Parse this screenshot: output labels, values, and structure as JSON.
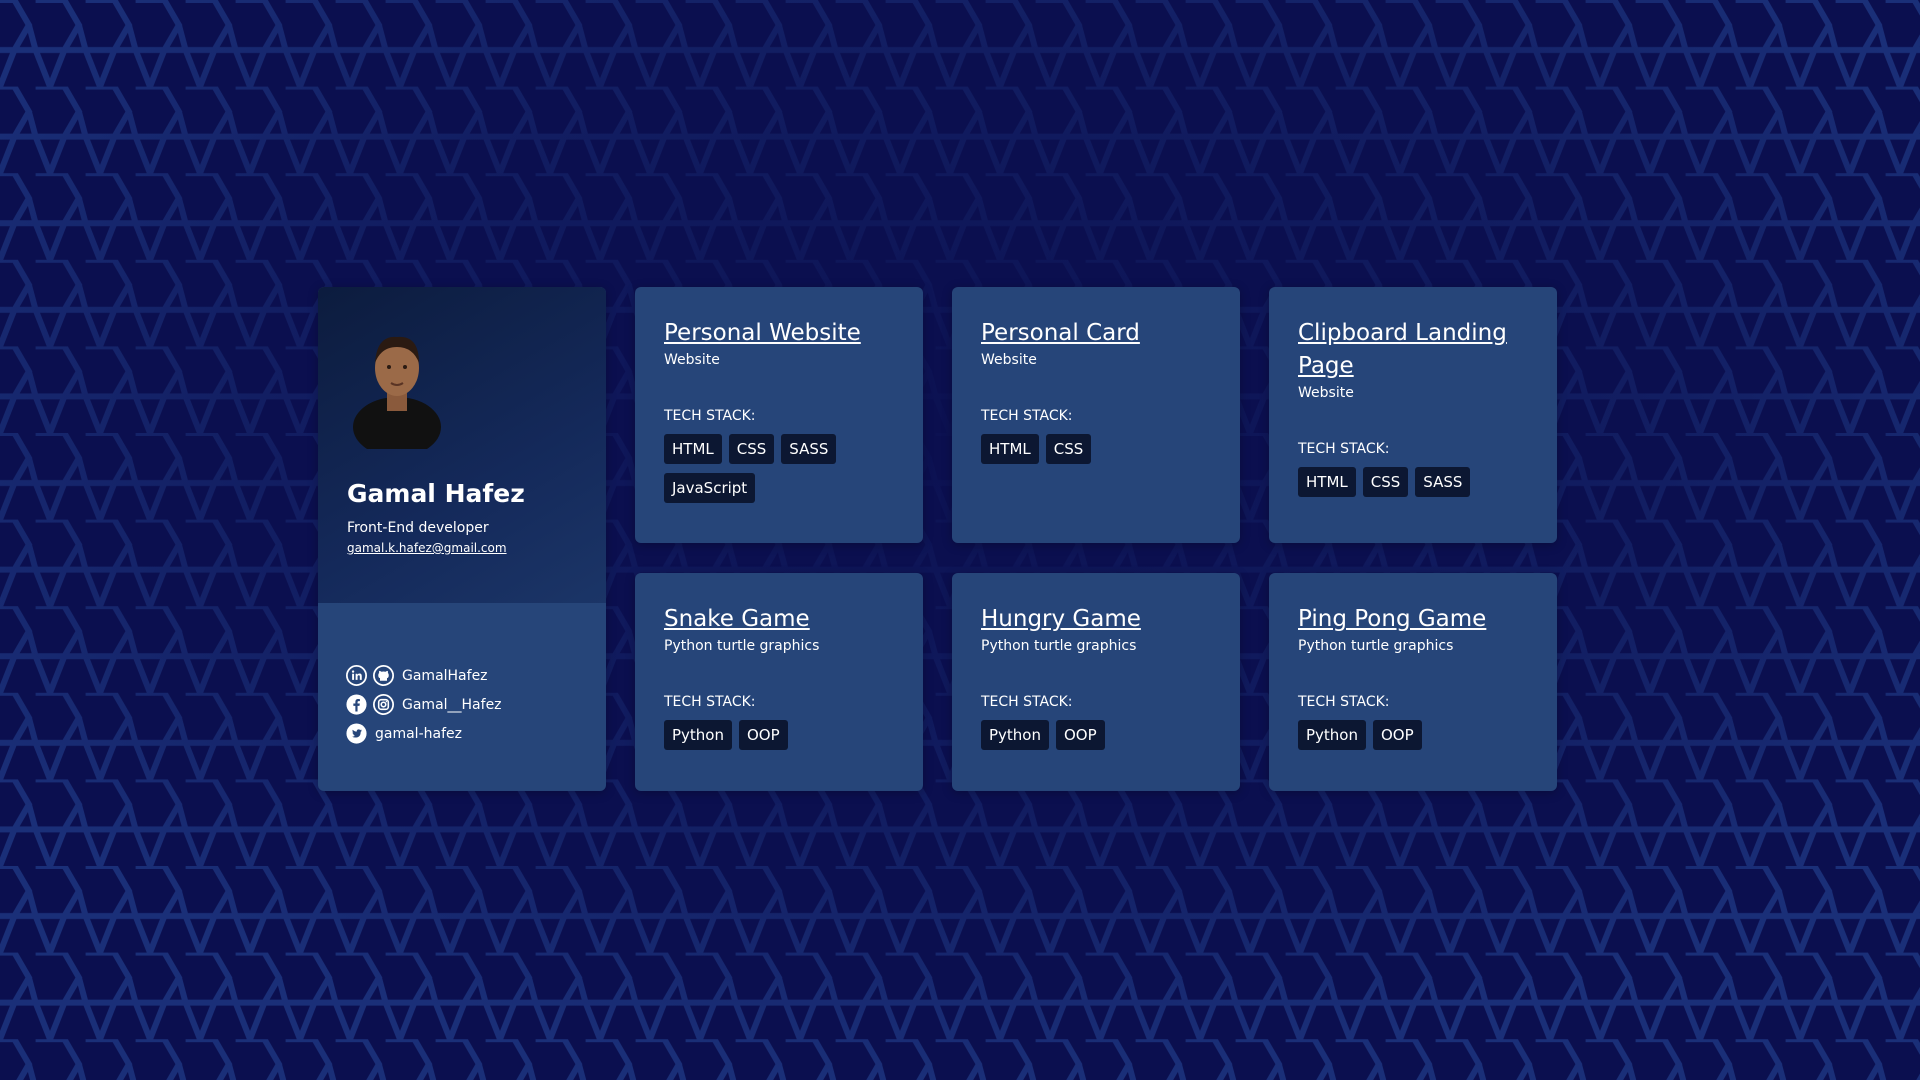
{
  "profile": {
    "name": "Gamal Hafez",
    "role": "Front-End developer",
    "email": "gamal.k.hafez@gmail.com",
    "socials": [
      {
        "icons": [
          "linkedin-icon",
          "github-icon"
        ],
        "handle": "GamalHafez"
      },
      {
        "icons": [
          "facebook-icon",
          "instagram-icon"
        ],
        "handle": "Gamal__Hafez"
      },
      {
        "icons": [
          "twitter-icon"
        ],
        "handle": "gamal-hafez"
      }
    ]
  },
  "tech_label": "TECH STACK:",
  "projects": [
    {
      "title": "Personal Website",
      "subtitle": "Website",
      "tags": [
        "HTML",
        "CSS",
        "SASS",
        "JavaScript"
      ]
    },
    {
      "title": "Personal Card",
      "subtitle": "Website",
      "tags": [
        "HTML",
        "CSS"
      ]
    },
    {
      "title": "Clipboard Landing Page",
      "subtitle": "Website",
      "tags": [
        "HTML",
        "CSS",
        "SASS"
      ]
    },
    {
      "title": "Snake Game",
      "subtitle": "Python turtle graphics",
      "tags": [
        "Python",
        "OOP"
      ]
    },
    {
      "title": "Hungry Game",
      "subtitle": "Python turtle graphics",
      "tags": [
        "Python",
        "OOP"
      ]
    },
    {
      "title": "Ping Pong Game",
      "subtitle": "Python turtle graphics",
      "tags": [
        "Python",
        "OOP"
      ]
    }
  ],
  "colors": {
    "background": "#0b0f4f",
    "hex_outline": "#1a2f78",
    "card": "#264579",
    "tag": "#0c1732"
  }
}
